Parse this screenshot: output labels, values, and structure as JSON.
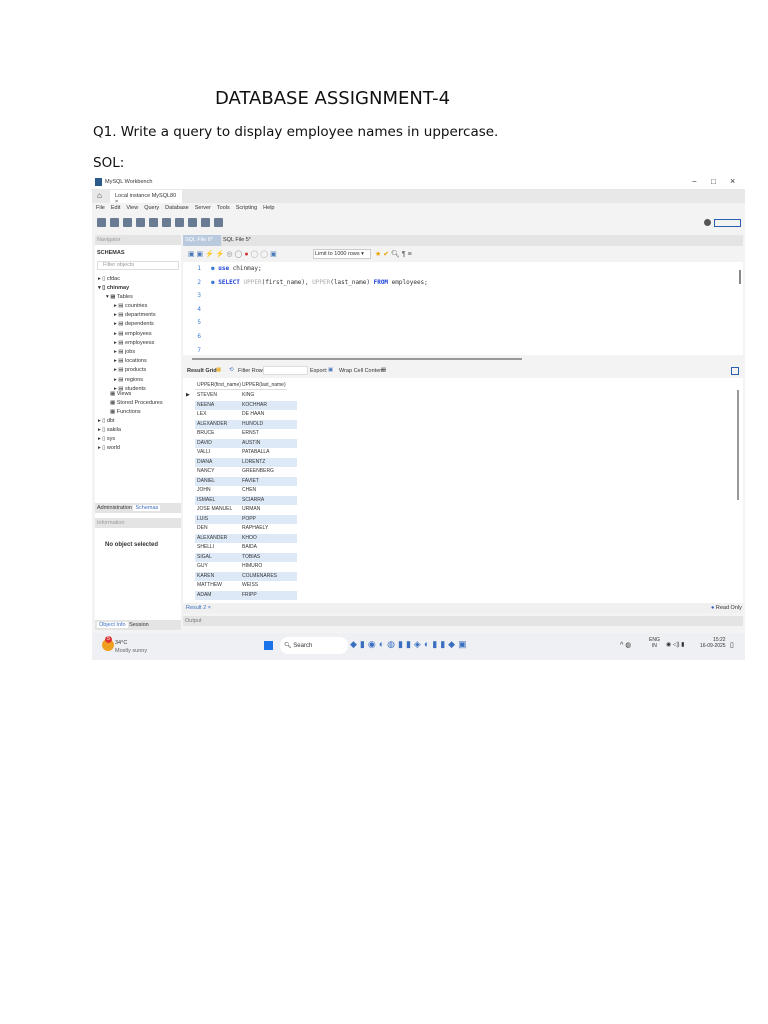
{
  "document": {
    "title": "DATABASE ASSIGNMENT-4",
    "question": "Q1. Write a query to display employee names in uppercase.",
    "solution_label": "SOL:"
  },
  "workbench": {
    "window_title": "MySQL Workbench",
    "window_controls": [
      "−",
      "□",
      "×"
    ],
    "connection_tab": "Local instance MySQL80",
    "menu": [
      "File",
      "Edit",
      "View",
      "Query",
      "Database",
      "Server",
      "Tools",
      "Scripting",
      "Help"
    ],
    "navigator": {
      "header": "Navigator",
      "schemas_label": "SCHEMAS",
      "filter_placeholder": "Filter objects",
      "schemas": [
        "cfdac",
        "chinmay",
        "dbt",
        "sakila",
        "sys",
        "world"
      ],
      "tables_label": "Tables",
      "tables": [
        "countries",
        "departments",
        "dependents",
        "employees",
        "employeess",
        "jobs",
        "locations",
        "products",
        "regions",
        "students"
      ],
      "other_nodes": [
        "Views",
        "Stored Procedures",
        "Functions"
      ],
      "bottom_tabs": [
        "Administration",
        "Schemas"
      ],
      "information_label": "Information",
      "no_object": "No object selected",
      "info_tabs": [
        "Object Info",
        "Session"
      ]
    },
    "editor_tabs": [
      "SQL File 6*",
      "SQL File 5*"
    ],
    "limit_select": "Limit to 1000 rows",
    "code_lines": [
      {
        "n": "1",
        "parts": [
          {
            "t": "use",
            "c": "kw"
          },
          {
            "t": " chinmay;",
            "c": ""
          }
        ]
      },
      {
        "n": "2",
        "parts": [
          {
            "t": "SELECT ",
            "c": "kw"
          },
          {
            "t": "UPPER",
            "c": "fn"
          },
          {
            "t": "(first_name), ",
            "c": ""
          },
          {
            "t": "UPPER",
            "c": "fn"
          },
          {
            "t": "(last_name) ",
            "c": ""
          },
          {
            "t": "FROM",
            "c": "kw"
          },
          {
            "t": " employees;",
            "c": ""
          }
        ]
      },
      {
        "n": "3",
        "parts": []
      },
      {
        "n": "4",
        "parts": []
      },
      {
        "n": "5",
        "parts": []
      },
      {
        "n": "6",
        "parts": []
      },
      {
        "n": "7",
        "parts": []
      }
    ],
    "result_toolbar": {
      "result_grid": "Result Grid",
      "filter_rows": "Filter Rows:",
      "export": "Export:",
      "wrap": "Wrap Cell Content:"
    },
    "columns": [
      "UPPER(first_name)",
      "UPPER(last_name)"
    ],
    "rows": [
      [
        "STEVEN",
        "KING"
      ],
      [
        "NEENA",
        "KOCHHAR"
      ],
      [
        "LEX",
        "DE HAAN"
      ],
      [
        "ALEXANDER",
        "HUNOLD"
      ],
      [
        "BRUCE",
        "ERNST"
      ],
      [
        "DAVID",
        "AUSTIN"
      ],
      [
        "VALLI",
        "PATABALLA"
      ],
      [
        "DIANA",
        "LORENTZ"
      ],
      [
        "NANCY",
        "GREENBERG"
      ],
      [
        "DANIEL",
        "FAVIET"
      ],
      [
        "JOHN",
        "CHEN"
      ],
      [
        "ISMAEL",
        "SCIARRA"
      ],
      [
        "JOSE MANUEL",
        "URMAN"
      ],
      [
        "LUIS",
        "POPP"
      ],
      [
        "DEN",
        "RAPHAELY"
      ],
      [
        "ALEXANDER",
        "KHOO"
      ],
      [
        "SHELLI",
        "BAIDA"
      ],
      [
        "SIGAL",
        "TOBIAS"
      ],
      [
        "GUY",
        "HIMURO"
      ],
      [
        "KAREN",
        "COLMENARES"
      ],
      [
        "MATTHEW",
        "WEISS"
      ],
      [
        "ADAM",
        "FRIPP"
      ]
    ],
    "result_tab": "Result 2",
    "read_only": "Read Only",
    "output_label": "Output"
  },
  "taskbar": {
    "weather_temp": "34°C",
    "weather_desc": "Mostly sunny",
    "weather_badge": "5",
    "search": "Search",
    "lang1": "ENG",
    "lang2": "IN",
    "time": "15:22",
    "date": "16-09-2025"
  }
}
